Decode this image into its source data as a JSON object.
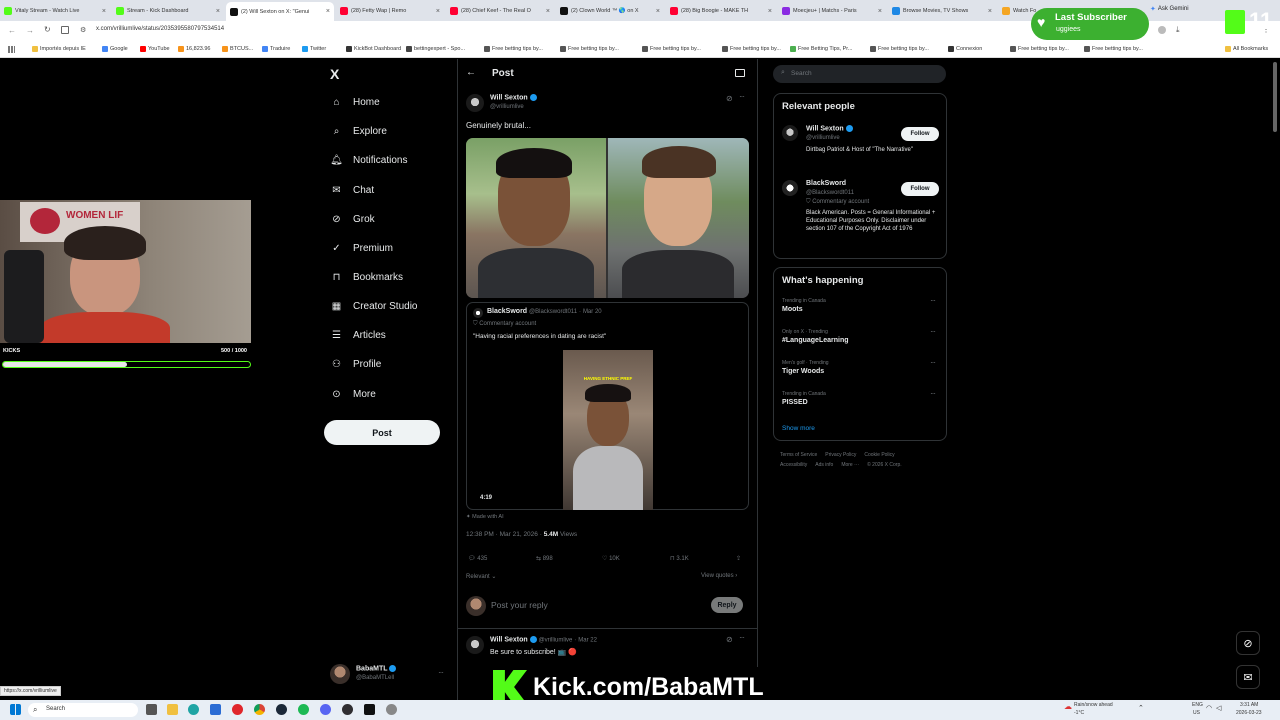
{
  "browser": {
    "tabs": [
      {
        "label": "Vitaly Stream - Watch Live",
        "color": "#53fc18"
      },
      {
        "label": "Stream - Kick Dashboard",
        "color": "#53fc18"
      },
      {
        "label": "(2) Will Sexton on X: \"Genui",
        "color": "#111111"
      },
      {
        "label": "(28) Fetty Wap | Remo",
        "color": "#ff0033"
      },
      {
        "label": "(28) Chief Keef - The Real O",
        "color": "#ff0033"
      },
      {
        "label": "(2) Clown World ™ 🌎 on X",
        "color": "#111111"
      },
      {
        "label": "(28) Big Boogie - MAKE TH",
        "color": "#ff0033"
      },
      {
        "label": "Moecjeu+ | Matchs - Paris",
        "color": "#8a2be2"
      },
      {
        "label": "Browse Movies, TV Shows",
        "color": "#1e88e5"
      },
      {
        "label": "Watch Fo",
        "color": "#f5a623"
      }
    ],
    "ask_gemini": "Ask Gemini",
    "url": "x.com/vrilliumlive/status/2035395580797534514",
    "bookmarks": [
      "Importés depuis IE",
      "Google",
      "YouTube",
      "16,823.96",
      "BTCUS...",
      "Traduire",
      "Twitter",
      "KickBot Dashboard",
      "bettingexpert - Spo...",
      "Free betting tips by...",
      "Free betting tips by...",
      "Free betting tips by...",
      "Free betting tips by...",
      "Free Betting Tips, Pr...",
      "Free betting tips by...",
      "Connexion",
      "Free betting tips by...",
      "Free betting tips by..."
    ],
    "all_bookmarks": "All Bookmarks",
    "status_url": "https://x.com/vrilliumlive"
  },
  "overlay": {
    "last_subscriber_title": "Last Subscriber",
    "last_subscriber_name": "uggiees",
    "kicks_label": "KICKS",
    "kicks_count": "500 / 1000",
    "kicks_progress": 0.5,
    "kick_banner": "Kick.com/BabaMTL",
    "counter": "11"
  },
  "sidebar": {
    "logo": "X",
    "items": [
      {
        "label": "Home",
        "icon": "home-icon"
      },
      {
        "label": "Explore",
        "icon": "search-icon"
      },
      {
        "label": "Notifications",
        "icon": "bell-icon"
      },
      {
        "label": "Chat",
        "icon": "mail-icon"
      },
      {
        "label": "Grok",
        "icon": "grok-icon"
      },
      {
        "label": "Premium",
        "icon": "premium-icon"
      },
      {
        "label": "Bookmarks",
        "icon": "bookmark-icon"
      },
      {
        "label": "Creator Studio",
        "icon": "creator-studio-icon"
      },
      {
        "label": "Articles",
        "icon": "articles-icon"
      },
      {
        "label": "Profile",
        "icon": "profile-icon"
      },
      {
        "label": "More",
        "icon": "more-icon"
      }
    ],
    "post_button": "Post",
    "account_name": "BabaMTL",
    "account_handle": "@BabaMTLell"
  },
  "post": {
    "header": "Post",
    "author_name": "Will Sexton",
    "author_handle": "@vrilliumlive",
    "text": "Genuinely brutal...",
    "quoted": {
      "name": "BlackSword",
      "handle": "@Blackswordt011",
      "date": "Mar 20",
      "label": "Commentary account",
      "text": "\"Having racial preferences in dating are racist\"",
      "video_caption": "HAVING ETHNIC PREF",
      "duration": "4:19"
    },
    "made_with_ai": "Made with AI",
    "time": "12:38 PM · Mar 21, 2026 ·",
    "views": "5.4M",
    "views_label": "Views",
    "stats": {
      "replies": "435",
      "reposts": "898",
      "likes": "10K",
      "bookmarks": "3.1K"
    },
    "relevant": "Relevant",
    "view_quotes": "View quotes",
    "reply_placeholder": "Post your reply",
    "reply_button": "Reply",
    "reply": {
      "name": "Will Sexton",
      "handle": "@vrilliumlive",
      "date": "Mar 22",
      "text": "Be sure to subscribe! 📺 🔴"
    }
  },
  "right": {
    "search_placeholder": "Search",
    "relevant_title": "Relevant people",
    "people": [
      {
        "name": "Will Sexton",
        "handle": "@vrilliumlive",
        "bio": "Dirtbag Patriot & Host of \"The Narrative\"",
        "follow": "Follow"
      },
      {
        "name": "BlackSword",
        "handle": "@Blackswordt011",
        "label": "Commentary account",
        "bio": "Black American. Posts = General Informational + Educational Purposes Only. Disclaimer under section 107 of the Copyright Act of 1976",
        "follow": "Follow"
      }
    ],
    "happening_title": "What's happening",
    "trends": [
      {
        "meta": "Trending in Canada",
        "name": "Moots"
      },
      {
        "meta": "Only on X · Trending",
        "name": "#LanguageLearning"
      },
      {
        "meta": "Men's golf · Trending",
        "name": "Tiger Woods"
      },
      {
        "meta": "Trending in Canada",
        "name": "PISSED"
      }
    ],
    "show_more": "Show more",
    "footer": [
      "Terms of Service",
      "Privacy Policy",
      "Cookie Policy",
      "Accessibility",
      "Ads info",
      "More ···",
      "© 2026 X Corp."
    ]
  },
  "taskbar": {
    "search": "Search",
    "weather": "Rain/snow ahead",
    "temp": "-1°C",
    "lang": "ENG",
    "region": "US",
    "time": "3:31 AM",
    "date": "2026-03-23"
  }
}
